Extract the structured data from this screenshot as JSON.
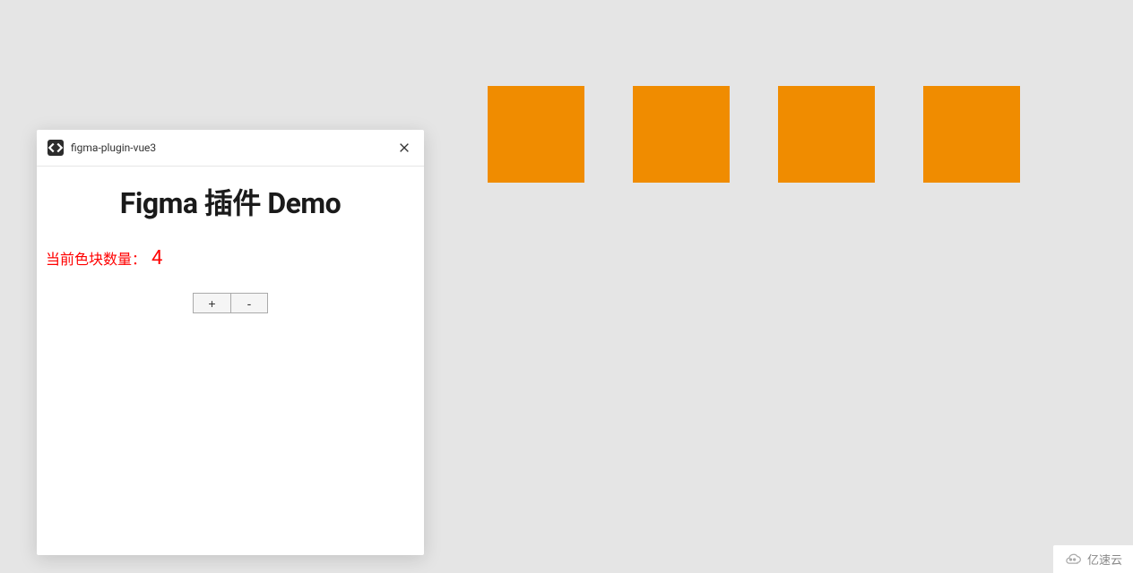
{
  "plugin": {
    "title": "figma-plugin-vue3",
    "heading": "Figma 插件 Demo",
    "count_label": "当前色块数量：",
    "count_value": "4",
    "increment_label": "+",
    "decrement_label": "-"
  },
  "canvas": {
    "block_color": "#f08c00",
    "block_count": 4
  },
  "watermark": {
    "text": "亿速云"
  }
}
